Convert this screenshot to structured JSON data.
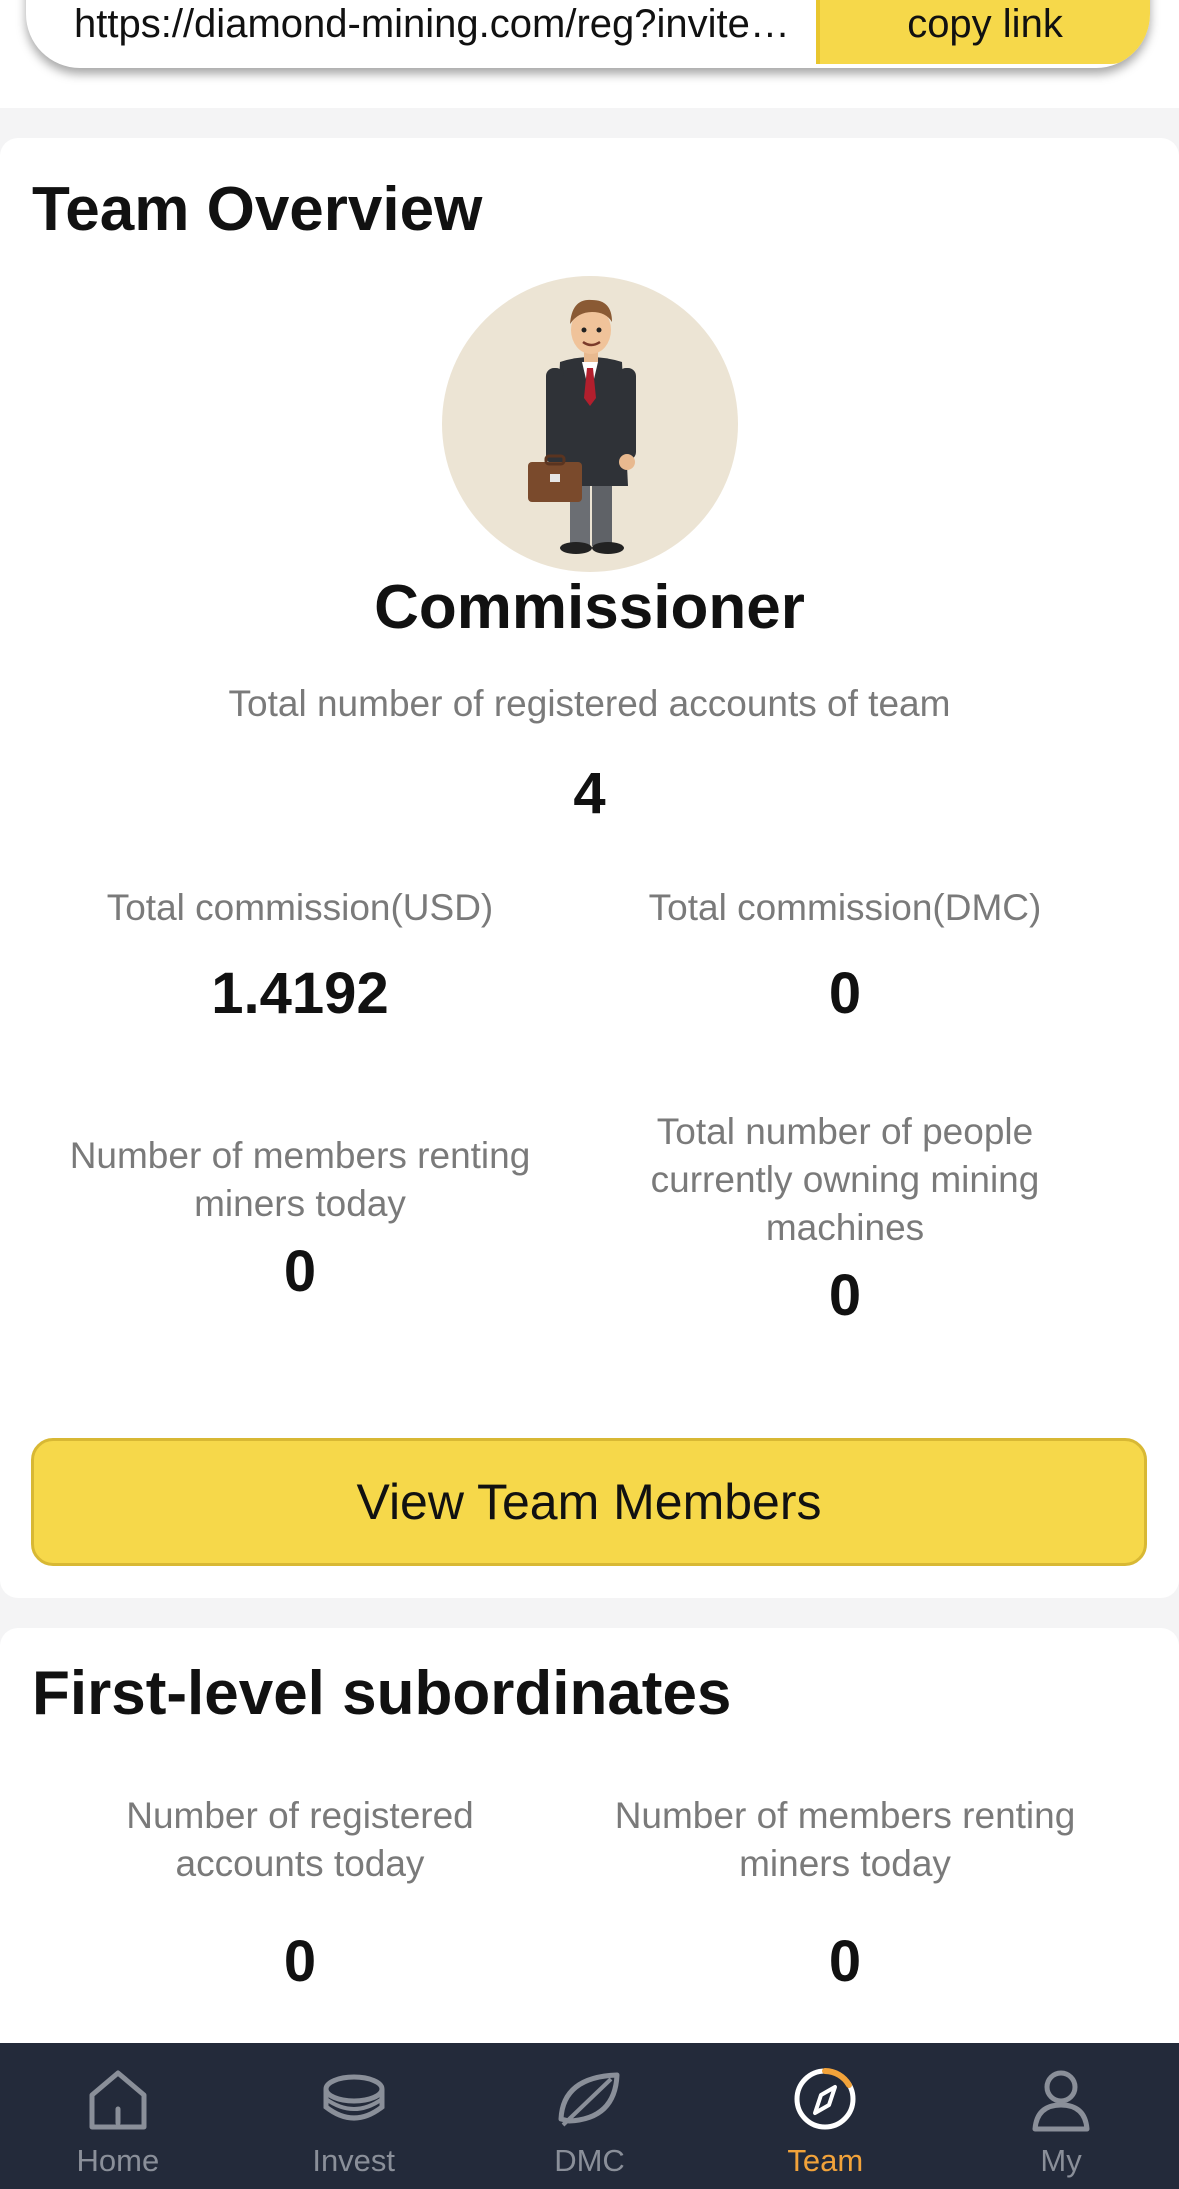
{
  "invite": {
    "link": "https://diamond-mining.com/reg?inviteCode=",
    "copy_label": "copy link"
  },
  "team_overview": {
    "title": "Team Overview",
    "rank": "Commissioner",
    "registered_label": "Total number of registered accounts of team",
    "registered_value": "4",
    "commission_usd_label": "Total commission(USD)",
    "commission_usd_value": "1.4192",
    "commission_dmc_label": "Total commission(DMC)",
    "commission_dmc_value": "0",
    "renting_today_label": "Number of members renting miners today",
    "renting_today_value": "0",
    "owning_label": "Total number of people currently owning mining machines",
    "owning_value": "0",
    "view_button": "View Team Members"
  },
  "first_level": {
    "title": "First-level subordinates",
    "registered_today_label": "Number of registered accounts today",
    "registered_today_value": "0",
    "renting_today_label": "Number of members renting miners today",
    "renting_today_value": "0"
  },
  "nav": {
    "items": [
      {
        "label": "Home",
        "icon": "home-icon"
      },
      {
        "label": "Invest",
        "icon": "coins-icon"
      },
      {
        "label": "DMC",
        "icon": "leaf-icon"
      },
      {
        "label": "Team",
        "icon": "compass-icon"
      },
      {
        "label": "My",
        "icon": "user-icon"
      }
    ],
    "active": "Team",
    "colors": {
      "background": "#232a3a",
      "inactive": "#8a8f99",
      "active": "#f2a33a"
    }
  },
  "colors": {
    "accent": "#f6d84a",
    "background": "#f4f4f5",
    "card": "#ffffff"
  }
}
